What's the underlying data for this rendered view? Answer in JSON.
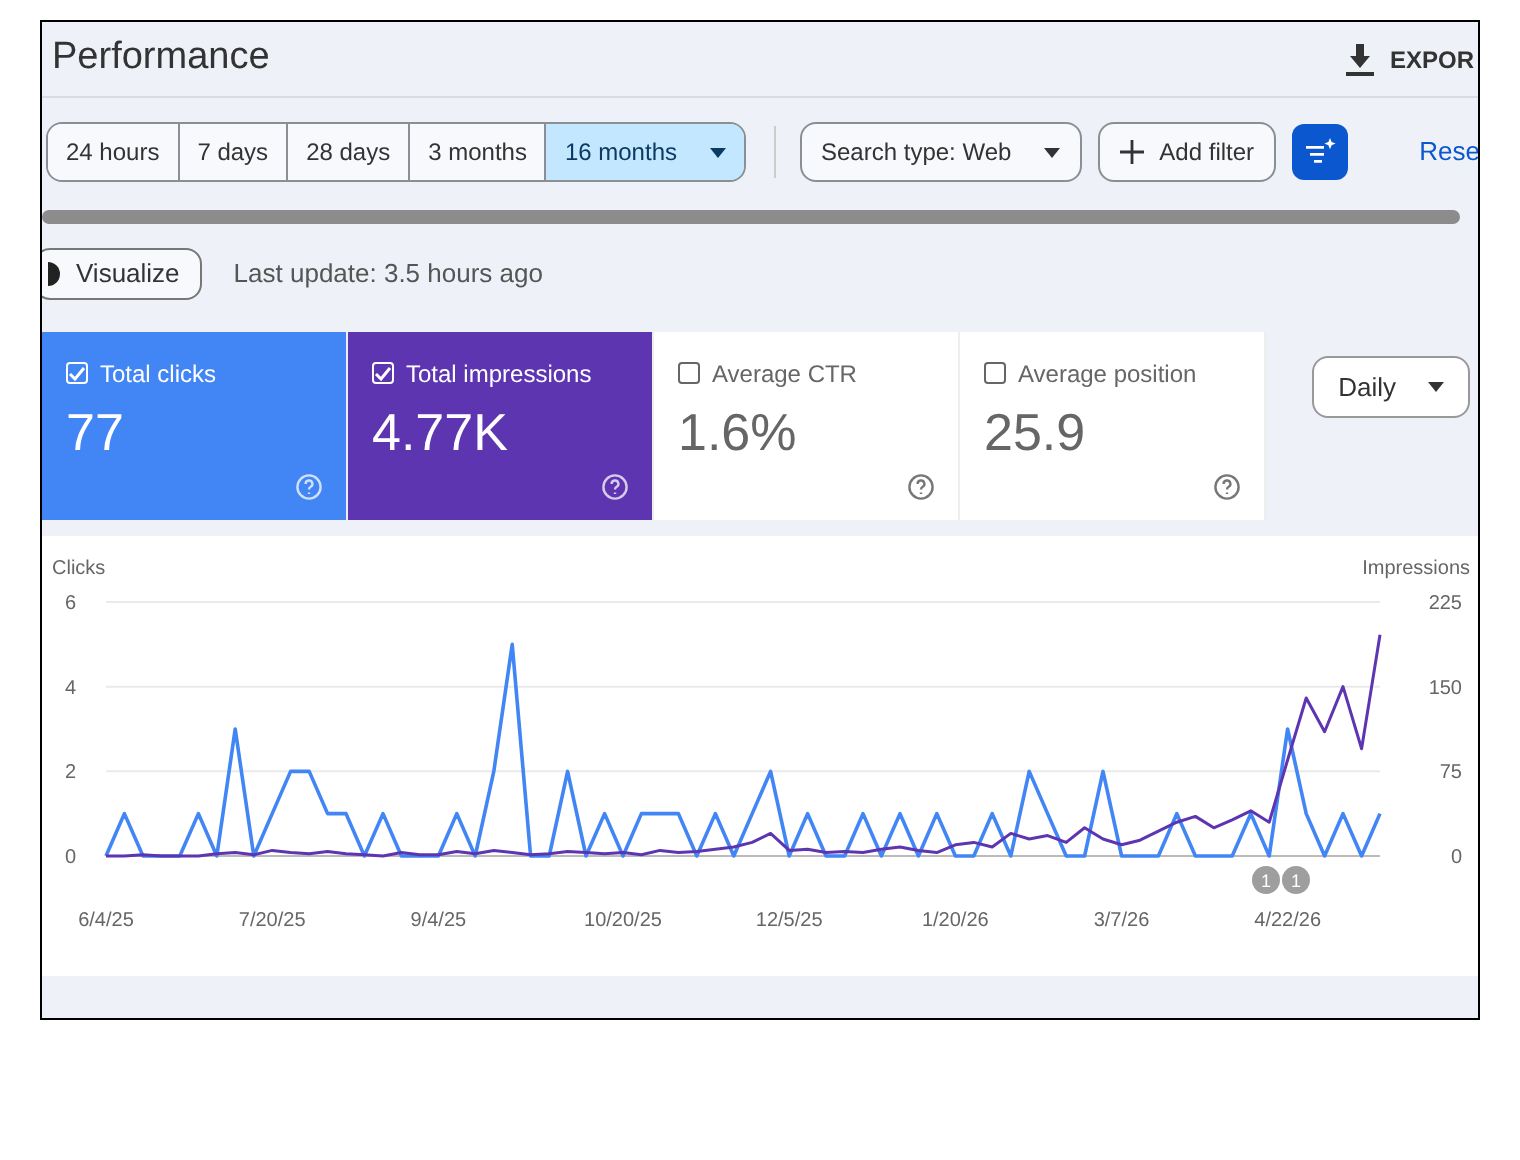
{
  "header": {
    "title": "Performance",
    "export_label": "EXPOR"
  },
  "date_ranges": [
    {
      "label": "24 hours",
      "selected": false
    },
    {
      "label": "7 days",
      "selected": false
    },
    {
      "label": "28 days",
      "selected": false
    },
    {
      "label": "3 months",
      "selected": false
    },
    {
      "label": "16 months",
      "selected": true
    }
  ],
  "filters": {
    "search_type": "Search type: Web",
    "add_filter": "Add filter",
    "reset": "Rese"
  },
  "visualize": {
    "label": "Visualize",
    "last_update": "Last update: 3.5 hours ago"
  },
  "metrics": [
    {
      "label": "Total clicks",
      "value": "77",
      "checked": true,
      "color": "#4285f4"
    },
    {
      "label": "Total impressions",
      "value": "4.77K",
      "checked": true,
      "color": "#5e35b1"
    },
    {
      "label": "Average CTR",
      "value": "1.6%",
      "checked": false
    },
    {
      "label": "Average position",
      "value": "25.9",
      "checked": false
    }
  ],
  "granularity": "Daily",
  "chart_data": {
    "type": "line",
    "ylabel": "Clicks",
    "y2label": "Impressions",
    "ylim": [
      0,
      6
    ],
    "yticks": [
      0,
      2,
      4,
      6
    ],
    "y2lim": [
      0,
      225
    ],
    "y2ticks": [
      0,
      75,
      150,
      225
    ],
    "categories": [
      "6/4/25",
      null,
      null,
      null,
      null,
      null,
      null,
      null,
      null,
      "7/20/25",
      null,
      null,
      null,
      null,
      null,
      null,
      null,
      null,
      "9/4/25",
      null,
      null,
      null,
      null,
      null,
      null,
      null,
      null,
      null,
      "10/20/25",
      null,
      null,
      null,
      null,
      null,
      null,
      null,
      null,
      "12/5/25",
      null,
      null,
      null,
      null,
      null,
      null,
      null,
      null,
      "1/20/26",
      null,
      null,
      null,
      null,
      null,
      null,
      null,
      null,
      "3/7/26",
      null,
      null,
      null,
      null,
      null,
      null,
      null,
      null,
      "4/22/26",
      null,
      null,
      null,
      null,
      null
    ],
    "series": [
      {
        "color": "#4285f4",
        "values": [
          0,
          1,
          0,
          0,
          0,
          1,
          0,
          3,
          0,
          1,
          2,
          2,
          1,
          1,
          0,
          1,
          0,
          0,
          0,
          1,
          0,
          2,
          5,
          0,
          0,
          2,
          0,
          1,
          0,
          1,
          1,
          1,
          0,
          1,
          0,
          1,
          2,
          0,
          1,
          0,
          0,
          1,
          0,
          1,
          0,
          1,
          0,
          0,
          1,
          0,
          2,
          1,
          0,
          0,
          2,
          0,
          0,
          0,
          1,
          0,
          0,
          0,
          1,
          0,
          3,
          1,
          0,
          1,
          0,
          1
        ]
      },
      {
        "color": "#5e35b1",
        "axis": "y2",
        "values": [
          0,
          0,
          1,
          0,
          0,
          0,
          2,
          3,
          1,
          5,
          3,
          2,
          4,
          2,
          1,
          0,
          3,
          1,
          1,
          4,
          2,
          5,
          3,
          1,
          2,
          4,
          3,
          2,
          3,
          1,
          5,
          3,
          4,
          6,
          8,
          12,
          20,
          5,
          6,
          3,
          4,
          3,
          6,
          8,
          5,
          3,
          10,
          12,
          8,
          20,
          15,
          18,
          12,
          25,
          15,
          10,
          14,
          22,
          30,
          35,
          25,
          32,
          40,
          30,
          85,
          140,
          110,
          150,
          95,
          196
        ]
      }
    ],
    "annotations": [
      "1",
      "1"
    ]
  }
}
